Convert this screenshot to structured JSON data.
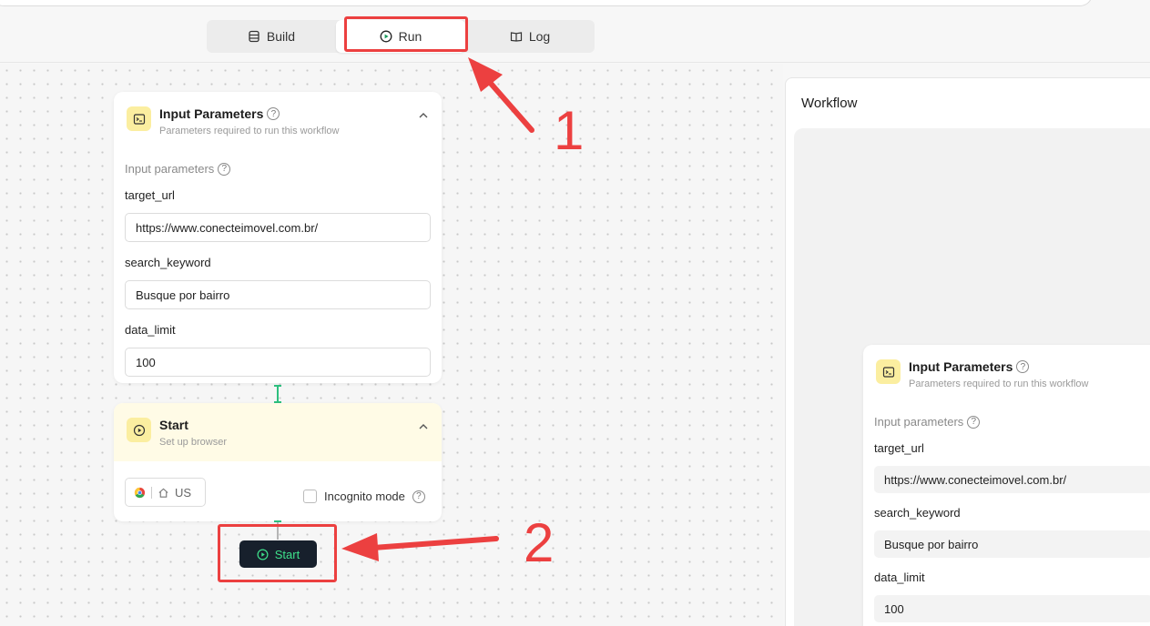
{
  "tabs": [
    {
      "label": "Build",
      "icon": "build-icon"
    },
    {
      "label": "Run",
      "icon": "play-circle-icon",
      "active": true
    },
    {
      "label": "Log",
      "icon": "book-icon"
    }
  ],
  "input_node": {
    "title": "Input Parameters",
    "subtitle": "Parameters required to run this workflow",
    "section_label": "Input parameters",
    "fields": [
      {
        "label": "target_url",
        "value": "https://www.conecteimovel.com.br/"
      },
      {
        "label": "search_keyword",
        "value": "Busque por bairro"
      },
      {
        "label": "data_limit",
        "value": "100"
      }
    ]
  },
  "start_node": {
    "title": "Start",
    "subtitle": "Set up browser",
    "region": "US",
    "incognito_label": "Incognito mode"
  },
  "start_button": {
    "label": "Start"
  },
  "right_panel": {
    "title": "Workflow",
    "node": {
      "title": "Input Parameters",
      "subtitle": "Parameters required to run this workflow",
      "section_label": "Input parameters",
      "fields": [
        {
          "label": "target_url",
          "value": "https://www.conecteimovel.com.br/"
        },
        {
          "label": "search_keyword",
          "value": "Busque por bairro"
        },
        {
          "label": "data_limit",
          "value": "100"
        }
      ]
    }
  },
  "annotations": [
    {
      "number": "1"
    },
    {
      "number": "2"
    }
  ],
  "colors": {
    "annotation": "#ec4040",
    "node_icon_bg": "#fbeea0",
    "start_button_bg": "#17202c",
    "start_button_text": "#3ee08b",
    "connector": "#2dbf7e"
  }
}
